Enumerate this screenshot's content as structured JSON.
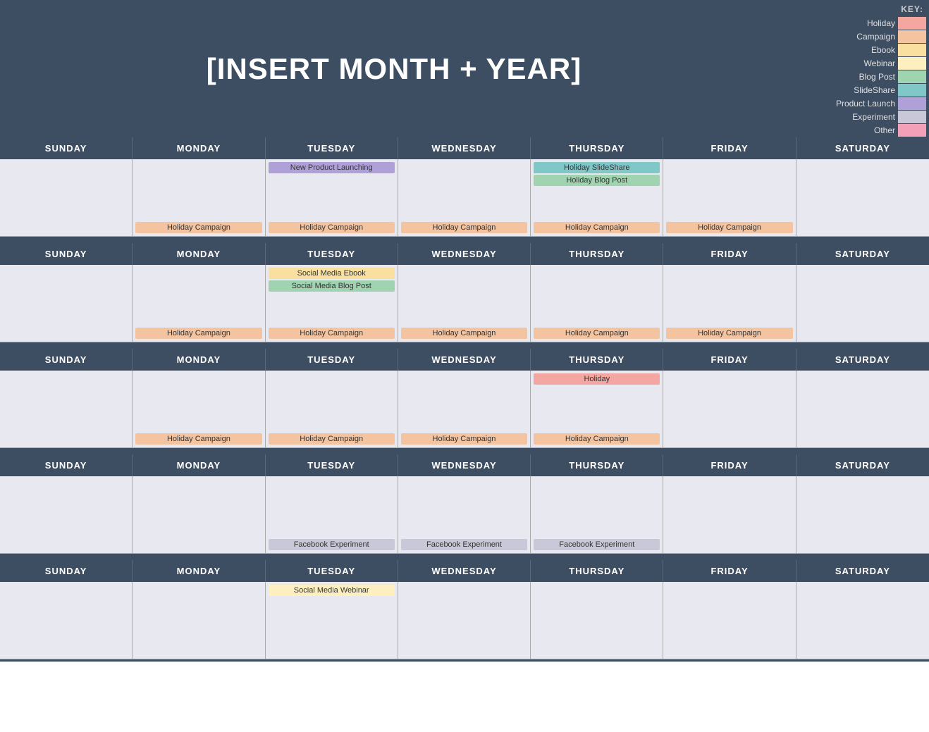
{
  "header": {
    "title": "[INSERT MONTH + YEAR]"
  },
  "key": {
    "label": "KEY:",
    "items": [
      {
        "id": "holiday",
        "label": "Holiday",
        "color": "#f4a6a0"
      },
      {
        "id": "campaign",
        "label": "Campaign",
        "color": "#f4c4a0"
      },
      {
        "id": "ebook",
        "label": "Ebook",
        "color": "#f9e0a0"
      },
      {
        "id": "webinar",
        "label": "Webinar",
        "color": "#fdefc0"
      },
      {
        "id": "blogpost",
        "label": "Blog Post",
        "color": "#a0d4b0"
      },
      {
        "id": "slideshare",
        "label": "SlideShare",
        "color": "#80c8c8"
      },
      {
        "id": "productlaunch",
        "label": "Product Launch",
        "color": "#b0a0d8"
      },
      {
        "id": "experiment",
        "label": "Experiment",
        "color": "#c8c8d8"
      },
      {
        "id": "other",
        "label": "Other",
        "color": "#f4a0b8"
      }
    ]
  },
  "calendar": {
    "days": [
      "SUNDAY",
      "MONDAY",
      "TUESDAY",
      "WEDNESDAY",
      "THURSDAY",
      "FRIDAY",
      "SATURDAY"
    ],
    "weeks": [
      {
        "cells": [
          {
            "top_events": [],
            "bottom_event": null
          },
          {
            "top_events": [],
            "bottom_event": {
              "label": "Holiday Campaign",
              "type": "campaign"
            }
          },
          {
            "top_events": [
              {
                "label": "New Product Launching",
                "type": "productlaunch"
              }
            ],
            "bottom_event": {
              "label": "Holiday Campaign",
              "type": "campaign"
            }
          },
          {
            "top_events": [],
            "bottom_event": {
              "label": "Holiday Campaign",
              "type": "campaign"
            }
          },
          {
            "top_events": [
              {
                "label": "Holiday SlideShare",
                "type": "slideshare"
              },
              {
                "label": "Holiday Blog Post",
                "type": "blogpost"
              }
            ],
            "bottom_event": {
              "label": "Holiday Campaign",
              "type": "campaign"
            }
          },
          {
            "top_events": [],
            "bottom_event": {
              "label": "Holiday Campaign",
              "type": "campaign"
            }
          },
          {
            "top_events": [],
            "bottom_event": null
          }
        ]
      },
      {
        "cells": [
          {
            "top_events": [],
            "bottom_event": null
          },
          {
            "top_events": [],
            "bottom_event": {
              "label": "Holiday Campaign",
              "type": "campaign"
            }
          },
          {
            "top_events": [
              {
                "label": "Social Media Ebook",
                "type": "ebook"
              },
              {
                "label": "Social Media Blog Post",
                "type": "blogpost"
              }
            ],
            "bottom_event": {
              "label": "Holiday Campaign",
              "type": "campaign"
            }
          },
          {
            "top_events": [],
            "bottom_event": {
              "label": "Holiday Campaign",
              "type": "campaign"
            }
          },
          {
            "top_events": [],
            "bottom_event": {
              "label": "Holiday Campaign",
              "type": "campaign"
            }
          },
          {
            "top_events": [],
            "bottom_event": {
              "label": "Holiday Campaign",
              "type": "campaign"
            }
          },
          {
            "top_events": [],
            "bottom_event": null
          }
        ]
      },
      {
        "cells": [
          {
            "top_events": [],
            "bottom_event": null
          },
          {
            "top_events": [],
            "bottom_event": {
              "label": "Holiday Campaign",
              "type": "campaign"
            }
          },
          {
            "top_events": [],
            "bottom_event": {
              "label": "Holiday Campaign",
              "type": "campaign"
            }
          },
          {
            "top_events": [],
            "bottom_event": {
              "label": "Holiday Campaign",
              "type": "campaign"
            }
          },
          {
            "top_events": [
              {
                "label": "Holiday",
                "type": "holiday"
              }
            ],
            "bottom_event": {
              "label": "Holiday Campaign",
              "type": "campaign"
            }
          },
          {
            "top_events": [],
            "bottom_event": null
          },
          {
            "top_events": [],
            "bottom_event": null
          }
        ]
      },
      {
        "cells": [
          {
            "top_events": [],
            "bottom_event": null
          },
          {
            "top_events": [],
            "bottom_event": null
          },
          {
            "top_events": [],
            "bottom_event": {
              "label": "Facebook Experiment",
              "type": "experiment"
            }
          },
          {
            "top_events": [],
            "bottom_event": {
              "label": "Facebook Experiment",
              "type": "experiment"
            }
          },
          {
            "top_events": [],
            "bottom_event": {
              "label": "Facebook Experiment",
              "type": "experiment"
            }
          },
          {
            "top_events": [],
            "bottom_event": null
          },
          {
            "top_events": [],
            "bottom_event": null
          }
        ]
      },
      {
        "cells": [
          {
            "top_events": [],
            "bottom_event": null
          },
          {
            "top_events": [],
            "bottom_event": null
          },
          {
            "top_events": [
              {
                "label": "Social Media Webinar",
                "type": "webinar"
              }
            ],
            "bottom_event": null
          },
          {
            "top_events": [],
            "bottom_event": null
          },
          {
            "top_events": [],
            "bottom_event": null
          },
          {
            "top_events": [],
            "bottom_event": null
          },
          {
            "top_events": [],
            "bottom_event": null
          }
        ]
      }
    ]
  }
}
